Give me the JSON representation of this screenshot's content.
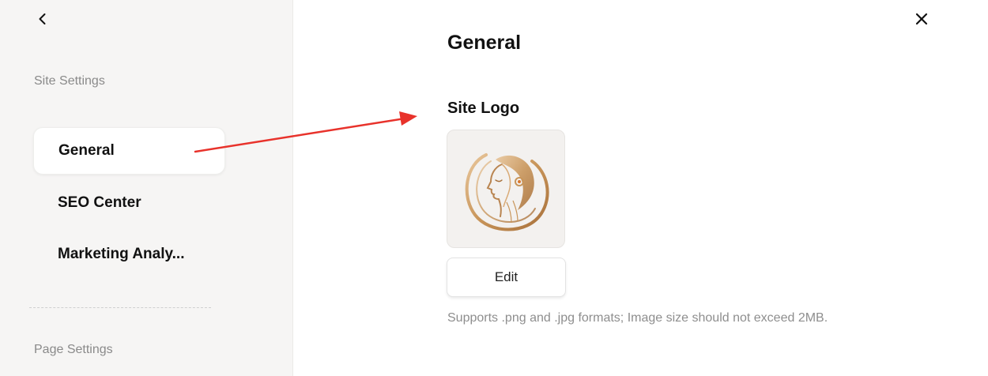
{
  "sidebar": {
    "back_icon": "chevron-left-icon",
    "site_settings_label": "Site Settings",
    "items": [
      {
        "label": "General",
        "active": true
      },
      {
        "label": "SEO Center",
        "active": false
      },
      {
        "label": "Marketing Analy...",
        "active": false
      }
    ],
    "page_settings_label": "Page Settings"
  },
  "header": {
    "close_icon": "close-icon"
  },
  "main": {
    "title": "General",
    "site_logo": {
      "heading": "Site Logo",
      "edit_label": "Edit",
      "hint": "Supports .png and .jpg formats; Image size should not exceed 2MB."
    }
  },
  "colors": {
    "sidebar_bg": "#f6f5f4",
    "logo_gold": "#c8955a",
    "annotation_red": "#e8322b"
  }
}
